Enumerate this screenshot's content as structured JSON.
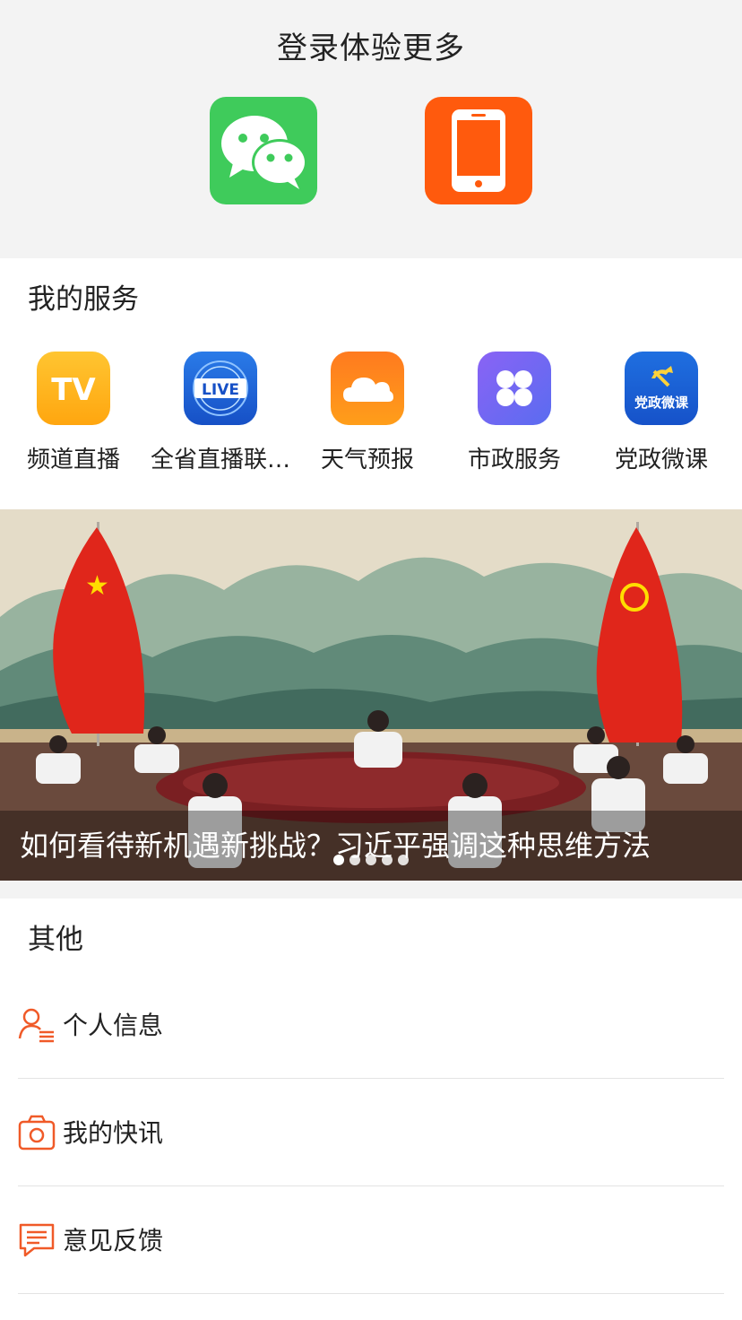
{
  "login": {
    "title": "登录体验更多",
    "buttons": [
      {
        "icon": "wechat-icon",
        "color": "#3fcb5b"
      },
      {
        "icon": "phone-icon",
        "color": "#ff5a0d"
      }
    ]
  },
  "services": {
    "title": "我的服务",
    "items": [
      {
        "label": "频道直播",
        "icon": "tv-icon"
      },
      {
        "label": "全省直播联…",
        "icon": "live-icon"
      },
      {
        "label": "天气预报",
        "icon": "weather-cloud-icon"
      },
      {
        "label": "市政服务",
        "icon": "city-services-icon"
      },
      {
        "label": "党政微课",
        "icon": "party-course-icon"
      }
    ],
    "icon_texts": {
      "tv": "TV",
      "live": "LIVE",
      "party": "党政微课"
    }
  },
  "banner": {
    "caption": "如何看待新机遇新挑战？习近平强调这种思维方法",
    "slide_count": 5,
    "active_slide": 1
  },
  "other": {
    "title": "其他",
    "items": [
      {
        "label": "个人信息",
        "icon": "user-info-icon"
      },
      {
        "label": "我的快讯",
        "icon": "camera-icon"
      },
      {
        "label": "意见反馈",
        "icon": "feedback-icon"
      }
    ]
  },
  "colors": {
    "accent": "#ff5a0d",
    "wechat": "#3fcb5b",
    "icon_stroke": "#f05a28"
  }
}
